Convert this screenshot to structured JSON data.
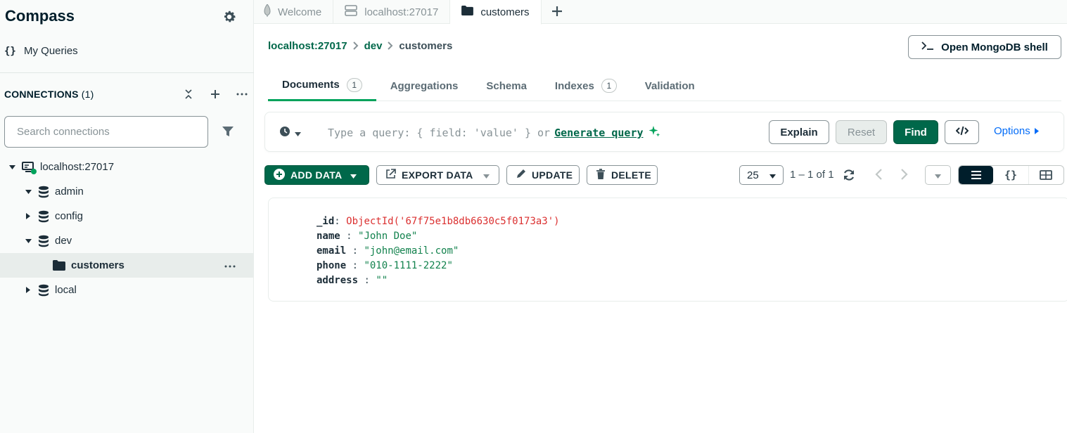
{
  "app": {
    "title": "Compass"
  },
  "sidebar": {
    "my_queries": "My Queries",
    "connections_label": "CONNECTIONS",
    "connections_count": "(1)",
    "search_placeholder": "Search connections",
    "tree": [
      {
        "label": "localhost:27017",
        "type": "connection",
        "expanded": true,
        "status_color": "#00a35c"
      },
      {
        "label": "admin",
        "type": "database",
        "expanded": true
      },
      {
        "label": "config",
        "type": "database",
        "expanded": false
      },
      {
        "label": "dev",
        "type": "database",
        "expanded": true
      },
      {
        "label": "customers",
        "type": "collection",
        "selected": true
      },
      {
        "label": "local",
        "type": "database",
        "expanded": false
      }
    ]
  },
  "tabs": [
    {
      "label": "Welcome",
      "icon": "leaf-icon",
      "active": false
    },
    {
      "label": "localhost:27017",
      "icon": "server-icon",
      "active": false
    },
    {
      "label": "customers",
      "icon": "folder-icon",
      "active": true
    }
  ],
  "breadcrumb": {
    "host": "localhost:27017",
    "db": "dev",
    "collection": "customers"
  },
  "shell_button": "Open MongoDB shell",
  "collection_tabs": [
    {
      "label": "Documents",
      "badge": "1",
      "active": true
    },
    {
      "label": "Aggregations",
      "badge": null,
      "active": false
    },
    {
      "label": "Schema",
      "badge": null,
      "active": false
    },
    {
      "label": "Indexes",
      "badge": "1",
      "active": false
    },
    {
      "label": "Validation",
      "badge": null,
      "active": false
    }
  ],
  "query_bar": {
    "placeholder": "Type a query: { field: 'value' } or",
    "generate_link": "Generate query",
    "explain": "Explain",
    "reset": "Reset",
    "find": "Find",
    "code_icon": "code-icon",
    "options": "Options"
  },
  "toolbar": {
    "add_data": "ADD DATA",
    "export_data": "EXPORT DATA",
    "update": "UPDATE",
    "delete": "DELETE",
    "page_size": "25",
    "range": "1 – 1 of 1",
    "view_modes": [
      "list",
      "json",
      "table"
    ],
    "active_view": "list"
  },
  "document": {
    "fields": [
      {
        "key": "_id",
        "value": "ObjectId('67f75e1b8db6630c5f0173a3')",
        "kind": "oid"
      },
      {
        "key": "name",
        "value": "\"John Doe\"",
        "kind": "str"
      },
      {
        "key": "email",
        "value": "\"john@email.com\"",
        "kind": "str"
      },
      {
        "key": "phone",
        "value": "\"010-1111-2222\"",
        "kind": "str"
      },
      {
        "key": "address",
        "value": "\"\"",
        "kind": "str"
      }
    ]
  },
  "colors": {
    "brand_green": "#00684a",
    "accent_green": "#00a35c",
    "link_blue": "#016bf8",
    "oid_red": "#db3030",
    "string_green": "#12824d"
  }
}
